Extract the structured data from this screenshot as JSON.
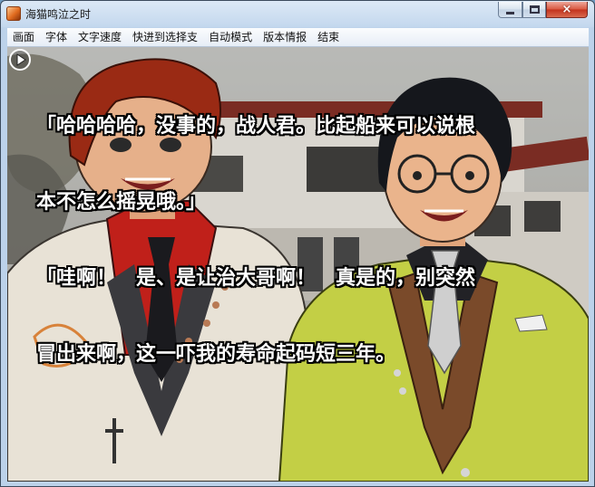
{
  "window": {
    "title": "海猫鸣泣之时",
    "icon": "app-icon",
    "controls": {
      "minimize": "minimize-icon",
      "maximize": "maximize-icon",
      "close": "×"
    }
  },
  "menu": {
    "items": [
      "画面",
      "字体",
      "文字速度",
      "快进到选择支",
      "自动模式",
      "版本情报",
      "结束"
    ]
  },
  "dialogue": {
    "lines": [
      "「哈哈哈哈，没事的，战人君。比起船来可以说根",
      "本不怎么摇晃哦。」",
      "「哇啊！　是、是让治大哥啊！　真是的，别突然",
      "冒出来啊，这一吓我的寿命起码短三年。"
    ]
  },
  "colors": {
    "title_bar": "#c4d8ee",
    "close_button": "#c2321d",
    "left_character_jacket": "#e8e2d6",
    "left_character_shirt": "#c0201a",
    "left_character_hair": "#9a2a14",
    "right_character_jacket": "#c3cf45",
    "right_character_vest": "#7a4a2a",
    "right_character_hair": "#15171c"
  }
}
